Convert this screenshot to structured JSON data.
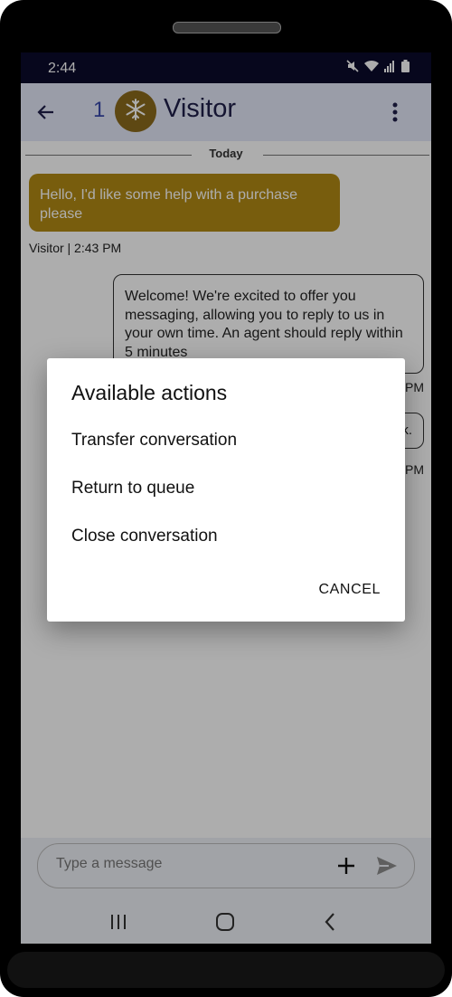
{
  "status_bar": {
    "time": "2:44"
  },
  "app_bar": {
    "unread_count": "1",
    "title": "Visitor"
  },
  "chat": {
    "date_divider": "Today",
    "visitor_message": "Hello, I'd like some help with a purchase please",
    "visitor_meta": "Visitor | 2:43 PM",
    "agent_message": "Welcome! We're excited to offer you messaging, allowing you to reply to us in your own time. An agent should reply within 5 minutes",
    "agent_meta_1": "PM",
    "agent_message_2": "k.",
    "agent_meta_2": "PM"
  },
  "composer": {
    "placeholder": "Type a message"
  },
  "dialog": {
    "title": "Available actions",
    "items": [
      {
        "label": "Transfer conversation"
      },
      {
        "label": "Return to queue"
      },
      {
        "label": "Close conversation"
      }
    ],
    "cancel_label": "CANCEL"
  },
  "colors": {
    "appbar_bg": "#e4e8f8",
    "visitor_bubble": "#b28a14",
    "avatar_bg": "#8b6a1c",
    "status_bar_bg": "#0b0b2c"
  }
}
